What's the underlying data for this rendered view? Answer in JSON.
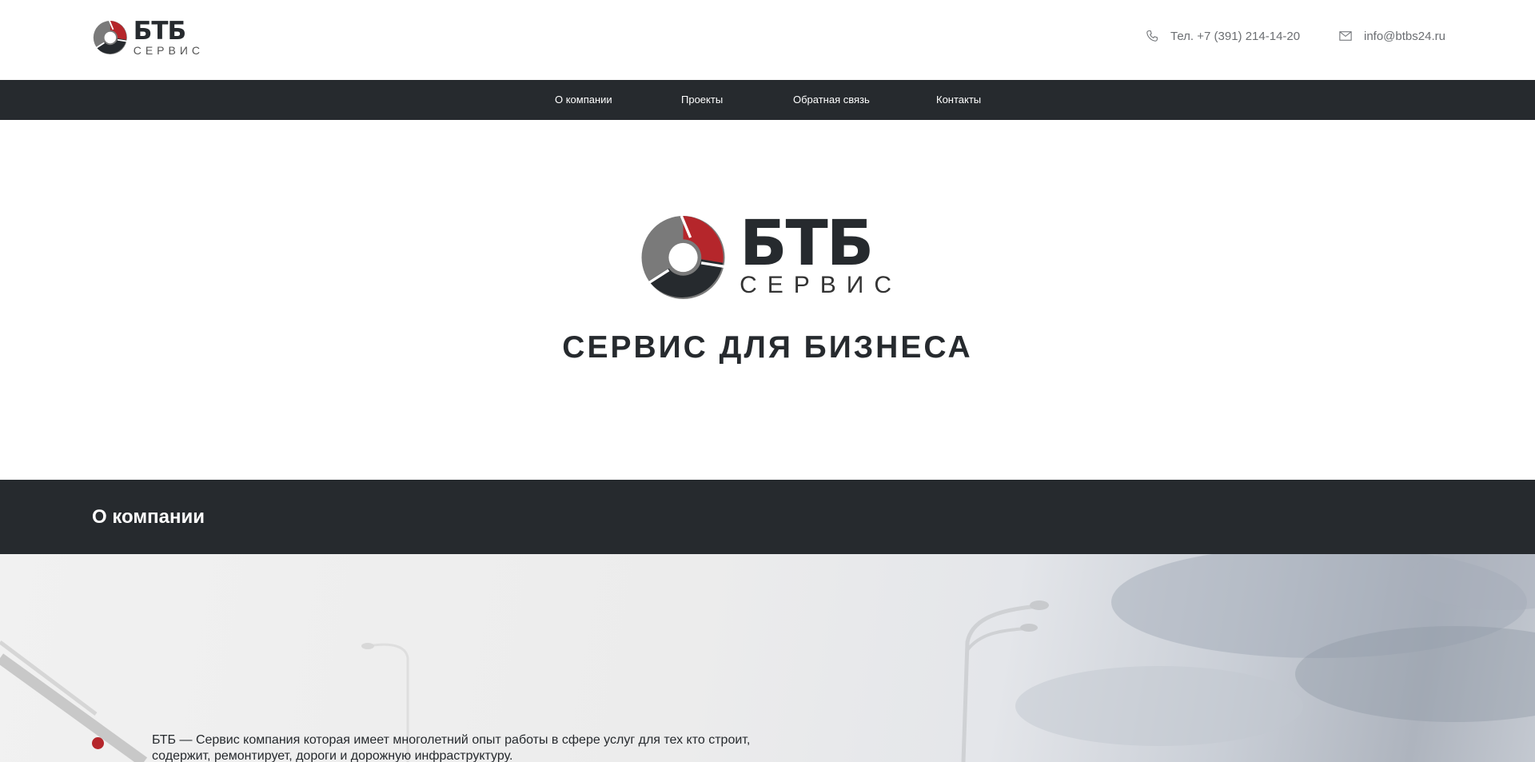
{
  "header": {
    "logo": {
      "main": "БТБ",
      "sub": "СЕРВИС"
    },
    "phone": {
      "icon": "phone-icon",
      "text": "Тел. +7 (391) 214-14-20"
    },
    "email": {
      "icon": "mail-icon",
      "text": "info@btbs24.ru"
    }
  },
  "nav": {
    "items": [
      {
        "label": "О компании"
      },
      {
        "label": "Проекты"
      },
      {
        "label": "Обратная связь"
      },
      {
        "label": "Контакты"
      }
    ]
  },
  "hero": {
    "logo": {
      "main": "БТБ",
      "sub": "СЕРВИС"
    },
    "title": "СЕРВИС ДЛЯ БИЗНЕСА"
  },
  "about": {
    "title": "О компании",
    "text": "БТБ — Сервис компания которая имеет многолетний опыт работы в сфере услуг для тех кто строит, содержит, ремонтирует, дороги и дорожную инфраструктуру."
  },
  "colors": {
    "dark": "#262a2e",
    "accent_red": "#b5262b",
    "logo_gray": "#7a7a7a"
  }
}
